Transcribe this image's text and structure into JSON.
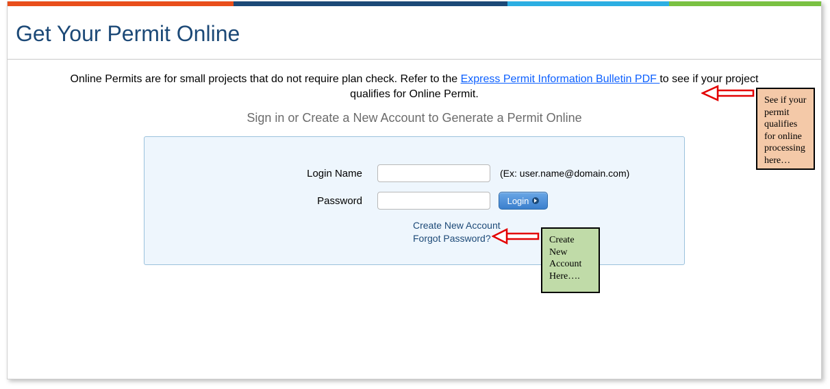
{
  "page": {
    "title": "Get Your Permit Online",
    "intro_prefix": "Online Permits are for small projects that do not require plan check. Refer to the  ",
    "intro_link": "Express Permit Information Bulletin PDF ",
    "intro_suffix": " to see if your project qualifies for Online Permit.",
    "subtitle": "Sign in or Create a New Account to Generate a Permit Online"
  },
  "form": {
    "login_label": "Login Name",
    "login_value": "",
    "login_hint": "(Ex: user.name@domain.com)",
    "password_label": "Password",
    "password_value": "",
    "login_button": "Login",
    "create_link": "Create New Account",
    "forgot_link": "Forgot Password?"
  },
  "annotations": {
    "peach": "See if your permit qualifies for online processing here…",
    "green": "Create New Account Here…."
  }
}
